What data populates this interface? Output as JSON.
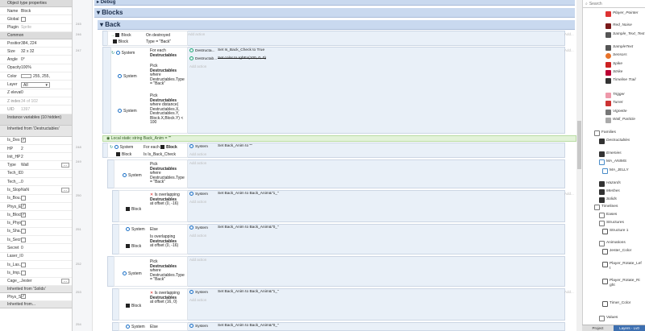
{
  "props": {
    "header": "Object type properties",
    "name_label": "Name",
    "name_value": "Block",
    "global_label": "Global",
    "plugin_label": "Plugin",
    "plugin_value": "Sprite",
    "common_header": "Common",
    "position_label": "Position",
    "position_value": "384, 224",
    "size_label": "Size",
    "size_value": "32 x 32",
    "angle_label": "Angle",
    "angle_value": "0°",
    "opacity_label": "Opacity",
    "opacity_value": "100%",
    "color_label": "Color",
    "color_value": "255, 255,",
    "layer_label": "Layer",
    "layer_value": "All",
    "zelev_label": "Z elevation",
    "zelev_value": "0",
    "zindex_label": "Z index",
    "zindex_value": "34 of 102",
    "uid_label": "UID",
    "uid_value": "1397",
    "instvars_header": "Instance variables (10 hidden)",
    "inherit1_header": "Inherited from 'Destructables'",
    "vars": [
      {
        "k": "Is_Des",
        "v": "",
        "cb": true
      },
      {
        "k": "HP",
        "v": "2"
      },
      {
        "k": "Init_HP",
        "v": "2"
      },
      {
        "k": "Type",
        "v": "Wall",
        "btn": true
      },
      {
        "k": "Tech_ID",
        "v": "0"
      },
      {
        "k": "Tech_...",
        "v": "0"
      },
      {
        "k": "Is_Slope",
        "v": "NaN",
        "btn": true
      },
      {
        "k": "Is_Bou...",
        "v": "",
        "cb": false
      },
      {
        "k": "Phys_E...",
        "v": "",
        "cb": true
      },
      {
        "k": "Is_Block",
        "v": "",
        "cb": true
      },
      {
        "k": "Is_Phys",
        "v": "",
        "cb": false
      },
      {
        "k": "Is_Sha...",
        "v": "",
        "cb": false
      },
      {
        "k": "Is_Secr...",
        "v": "",
        "cb": false
      },
      {
        "k": "Secret",
        "v": "0"
      },
      {
        "k": "Laser_ID",
        "v": "0"
      },
      {
        "k": "Is_Las...",
        "v": "",
        "cb": false
      },
      {
        "k": "Is_Imp...",
        "v": "",
        "cb": false
      },
      {
        "k": "Cage_...",
        "v": "Jester",
        "btn": true
      }
    ],
    "inherit2_header": "Inherited from 'Solids'",
    "phys_label": "Phys_S...",
    "bottom_label": "Inherited from..."
  },
  "lines": [
    "245",
    "246",
    "",
    "247",
    "",
    "",
    "",
    "",
    "",
    "",
    "",
    "",
    "",
    "",
    "248",
    "249",
    "",
    "",
    "",
    "",
    "",
    "250",
    "",
    "",
    "",
    "251",
    "",
    "252",
    "",
    "",
    "",
    "253",
    "",
    "",
    "254"
  ],
  "events": {
    "debug": "Debug",
    "blocks": "Blocks",
    "back": "Back",
    "e1": {
      "c1": "Block",
      "c1b": "On destroyed",
      "c2": "Block",
      "c2b": "Type = \"Back\"",
      "add_action": "Add action",
      "add": "Add..."
    },
    "e2": {
      "sys": "System",
      "foreach": "For each",
      "foreach_obj": "Destructables",
      "pick": "Pick",
      "pick_obj": "Destructables",
      "pick_where": "where Destructables.Type = \"Back\"",
      "pick2": "Pick",
      "pick2_obj": "Destructables",
      "pick2_where": "where distance( Destructables.X, Destructables.Y, Block.X,Block.Y) < 100",
      "a1_obj": "Destructa...",
      "a1": "Set Is_Back_Check to True",
      "a2_obj": "Destructab...",
      "a2": "Set color to rgbEx(100, 0, 0)",
      "add_action": "Add action",
      "add": "Add..."
    },
    "local": "Local static string Back_Anim = \"\"",
    "e3": {
      "sys": "System",
      "foreach": "For each",
      "foreach_obj": "Block",
      "c2": "Block",
      "c2b": "Is Is_Back_Check",
      "a_sys": "System",
      "a": "Set Back_Anim to \"\"",
      "add_action": "Add action"
    },
    "e4": {
      "sys": "System",
      "pick": "Pick",
      "obj": "Destructables",
      "where": "where Destructables.Type = \"Back\"",
      "add_action": "Add action"
    },
    "e5": {
      "blk": "Block",
      "not": "Is overlapping",
      "obj": "Destructables",
      "off": "at offset (0, -16)",
      "a_sys": "System",
      "a": "Set Back_Anim to Back_Anim&\"1_\"",
      "add_action": "Add action",
      "add": "Add..."
    },
    "e6": {
      "sys": "System",
      "else": "Else",
      "blk": "Block",
      "ov": "Is overlapping",
      "obj": "Destructables",
      "off": "at offset (0, -16)",
      "a_sys": "System",
      "a": "Set Back_Anim to Back_Anim&\"0_\"",
      "add_action": "Add action"
    },
    "e7": {
      "sys": "System",
      "pick": "Pick",
      "obj": "Destructables",
      "where": "where Destructables.Type = \"Back\"",
      "add_action": "Add action"
    },
    "e8": {
      "blk": "Block",
      "not": "Is overlapping",
      "obj": "Destructables",
      "off": "at offset (16, 0)",
      "a_sys": "System",
      "a": "Set Back_Anim to Back_Anim&\"1_\"",
      "add_action": "Add action",
      "add": "Add..."
    },
    "e9": {
      "sys": "System",
      "else": "Else",
      "a_sys": "System",
      "a": "Set Back_Anim to Back_Anim&\"0_\""
    }
  },
  "project": {
    "search_placeholder": "Search",
    "items": [
      {
        "label": "Player_Pointer",
        "color": "#d33",
        "italic": true
      },
      {
        "label": "Red_Noise",
        "color": "#7a1a1a",
        "italic": true
      },
      {
        "label": "Sample_Text_Text",
        "color": "#555",
        "italic": true
      },
      {
        "label": "SampleText",
        "color": "#555",
        "italic": true
      },
      {
        "label": "Sensors",
        "color": "#e8732a",
        "italic": true
      },
      {
        "label": "Spike",
        "color": "#c22",
        "italic": true
      },
      {
        "label": "Strike",
        "color": "#b03",
        "italic": true
      },
      {
        "label": "Timeline Trail",
        "color": "#333",
        "italic": true
      },
      {
        "label": "Trigger",
        "color": "#e9a",
        "italic": true
      },
      {
        "label": "Turret",
        "color": "#c33",
        "italic": true
      },
      {
        "label": "Vignette",
        "color": "#777",
        "italic": true
      },
      {
        "label": "Wall_Particle",
        "color": "#aaa",
        "italic": true
      },
      {
        "label": "Families",
        "color": "#777",
        "italic": false
      },
      {
        "label": "Destructables",
        "color": "#333",
        "italic": true
      },
      {
        "label": "Enemies",
        "color": "#333",
        "italic": true
      },
      {
        "label": "MA_ANIMS",
        "color": "#4a8cc8",
        "italic": false
      },
      {
        "label": "MA_JELLY",
        "color": "#4a8cc8",
        "italic": false
      },
      {
        "label": "Hazards",
        "color": "#333",
        "italic": true
      },
      {
        "label": "Meshes",
        "color": "#333",
        "italic": true
      },
      {
        "label": "Solids",
        "color": "#333",
        "italic": true
      },
      {
        "label": "Timelines",
        "color": "#777",
        "italic": false
      },
      {
        "label": "Eases",
        "color": "#777",
        "italic": false
      },
      {
        "label": "Structures",
        "color": "#777",
        "italic": false
      },
      {
        "label": "Structure 1",
        "color": "#555",
        "italic": false
      },
      {
        "label": "Animations",
        "color": "#777",
        "italic": false
      },
      {
        "label": "Jester_Color",
        "color": "#555",
        "italic": false
      },
      {
        "label": "Player_Rotate_Left",
        "color": "#555",
        "italic": false
      },
      {
        "label": "Player_Rotate_Right",
        "color": "#555",
        "italic": false
      },
      {
        "label": "Timer_Color",
        "color": "#555",
        "italic": false
      },
      {
        "label": "Values",
        "color": "#777",
        "italic": false
      }
    ],
    "tab_project": "Project",
    "tab_layers": "Layers - Lv0"
  }
}
